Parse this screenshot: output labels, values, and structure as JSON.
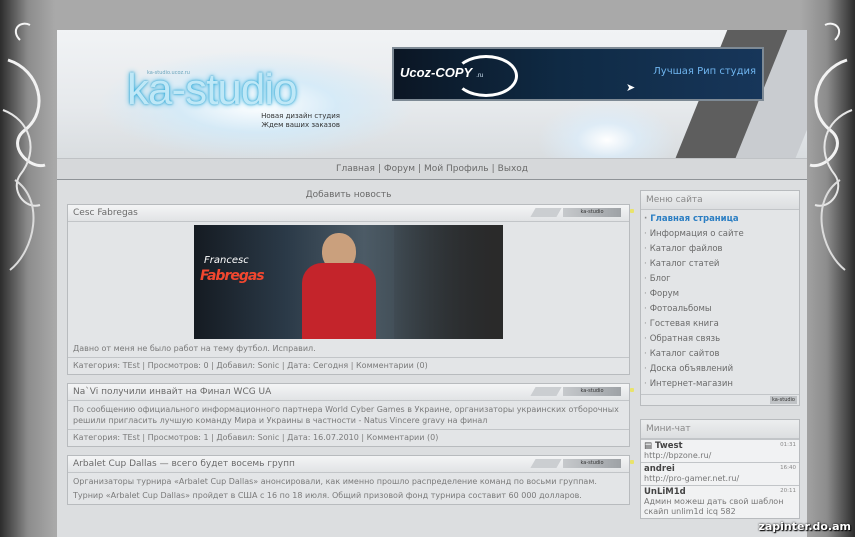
{
  "header": {
    "logo_text": "ka-studio",
    "logo_small": "ka-studio.ucoz.ru",
    "tagline_1": "Новая дизайн студия",
    "tagline_2": "Ждем ваших заказов",
    "banner_brand": "Ucoz-COPY",
    "banner_domain": ".ru",
    "banner_slogan": "Лучшая Рип студия"
  },
  "nav": {
    "items": [
      "Главная",
      "Форум",
      "Мой Профиль",
      "Выход"
    ]
  },
  "main": {
    "add_news": "Добавить новость",
    "posts": [
      {
        "title": "Cesc Fabregas",
        "tag": "ka-studio",
        "image_text_1": "Francesc",
        "image_text_2": "Fabregas",
        "body": "Давно от меня не было работ на тему футбол. Исправил.",
        "meta": "Категория: TEst | Просмотров: 0 | Добавил: Sonic | Дата: Сегодня | Комментарии (0)"
      },
      {
        "title": "Na`Vi получили инвайт на Финал WCG UA",
        "tag": "ka-studio",
        "body": "По сообщению официального информационного партнера World Cyber Games в Украине, организаторы украинских отборочных решили пригласить лучшую команду Мира и Украины в частности - Natus Vincere gravy на финал",
        "meta": "Категория: TEst | Просмотров: 1 | Добавил: Sonic | Дата: 16.07.2010 | Комментарии (0)"
      },
      {
        "title": "Arbalet Cup Dallas — всего будет восемь групп",
        "tag": "ka-studio",
        "body": "Организаторы турнира «Arbalet Cup Dallas» анонсировали, как именно прошло распределение команд по восьми группам.",
        "body2": "Турнир «Arbalet Cup Dallas» пройдет в США с 16 по 18 июля. Общий призовой фонд турнира составит 60 000 долларов."
      }
    ]
  },
  "sidebar": {
    "menu_title": "Меню сайта",
    "menu_items": [
      "Главная страница",
      "Информация о сайте",
      "Каталог файлов",
      "Каталог статей",
      "Блог",
      "Форум",
      "Фотоальбомы",
      "Гостевая книга",
      "Обратная связь",
      "Каталог сайтов",
      "Доска объявлений",
      "Интернет-магазин"
    ],
    "menu_tag": "ka-studio",
    "chat_title": "Мини-чат",
    "chat": [
      {
        "user": "Twest",
        "time": "01:31",
        "text": "http://bpzone.ru/"
      },
      {
        "user": "andrei",
        "time": "16:40",
        "text": "http://pro-gamer.net.ru/"
      },
      {
        "user": "UnLiM1d",
        "time": "20:11",
        "text": "Админ можеш дать свой шаблон скайп unlim1d icq 582"
      }
    ]
  },
  "watermark": "zapinter.do.am"
}
